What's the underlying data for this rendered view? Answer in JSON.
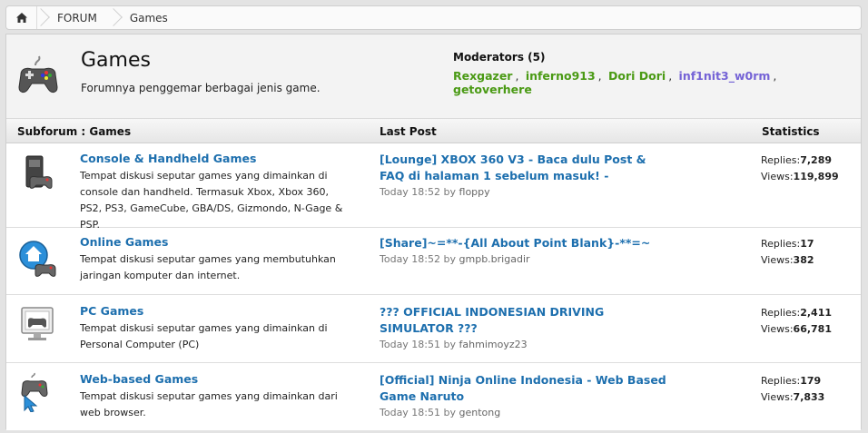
{
  "breadcrumb": {
    "home_icon": "home-icon",
    "items": [
      "FORUM",
      "Games"
    ]
  },
  "forum": {
    "title": "Games",
    "description": "Forumnya penggemar berbagai jenis game.",
    "icon": "gamepad-icon",
    "moderators": {
      "label": "Moderators (5)",
      "list": [
        {
          "name": "Rexgazer",
          "color": "#4a9a14"
        },
        {
          "name": "inferno913",
          "color": "#4a9a14"
        },
        {
          "name": "Dori Dori",
          "color": "#4a9a14"
        },
        {
          "name": "inf1nit3_w0rm",
          "color": "#7563d6"
        },
        {
          "name": "getoverhere",
          "color": "#4a9a14"
        }
      ]
    }
  },
  "table": {
    "col_subforum": "Subforum : Games",
    "col_lastpost": "Last Post",
    "col_stats": "Statistics"
  },
  "subforums": [
    {
      "name": "Console & Handheld Games",
      "icon": "console-icon",
      "description": "Tempat diskusi seputar games yang dimainkan di console dan handheld. Termasuk Xbox, Xbox 360, PS2, PS3, GameCube, GBA/DS, Gizmondo, N-Gage & PSP.",
      "last_post_title": "[Lounge] XBOX 360 V3 - Baca dulu Post & FAQ di halaman 1 sebelum masuk! -",
      "last_post_time": "Today 18:52",
      "by_label": "by",
      "last_post_user": "floppy",
      "replies_label": "Replies:",
      "replies": "7,289",
      "views_label": "Views:",
      "views": "119,899"
    },
    {
      "name": "Online Games",
      "icon": "online-games-icon",
      "description": "Tempat diskusi seputar games yang membutuhkan jaringan komputer dan internet.",
      "last_post_title": "[Share]~=**-{All About Point Blank}-**=~",
      "last_post_time": "Today 18:52",
      "by_label": "by",
      "last_post_user": "gmpb.brigadir",
      "replies_label": "Replies:",
      "replies": "17",
      "views_label": "Views:",
      "views": "382"
    },
    {
      "name": "PC Games",
      "icon": "pc-games-icon",
      "description": "Tempat diskusi seputar games yang dimainkan di Personal Computer (PC)",
      "last_post_title": "??? OFFICIAL INDONESIAN DRIVING SIMULATOR ???",
      "last_post_time": "Today 18:51",
      "by_label": "by",
      "last_post_user": "fahmimoyz23",
      "replies_label": "Replies:",
      "replies": "2,411",
      "views_label": "Views:",
      "views": "66,781"
    },
    {
      "name": "Web-based Games",
      "icon": "web-games-icon",
      "description": "Tempat diskusi seputar games yang dimainkan dari web browser.",
      "last_post_title": "[Official] Ninja Online Indonesia - Web Based Game Naruto",
      "last_post_time": "Today 18:51",
      "by_label": "by",
      "last_post_user": "gentong",
      "replies_label": "Replies:",
      "replies": "179",
      "views_label": "Views:",
      "views": "7,833"
    }
  ]
}
